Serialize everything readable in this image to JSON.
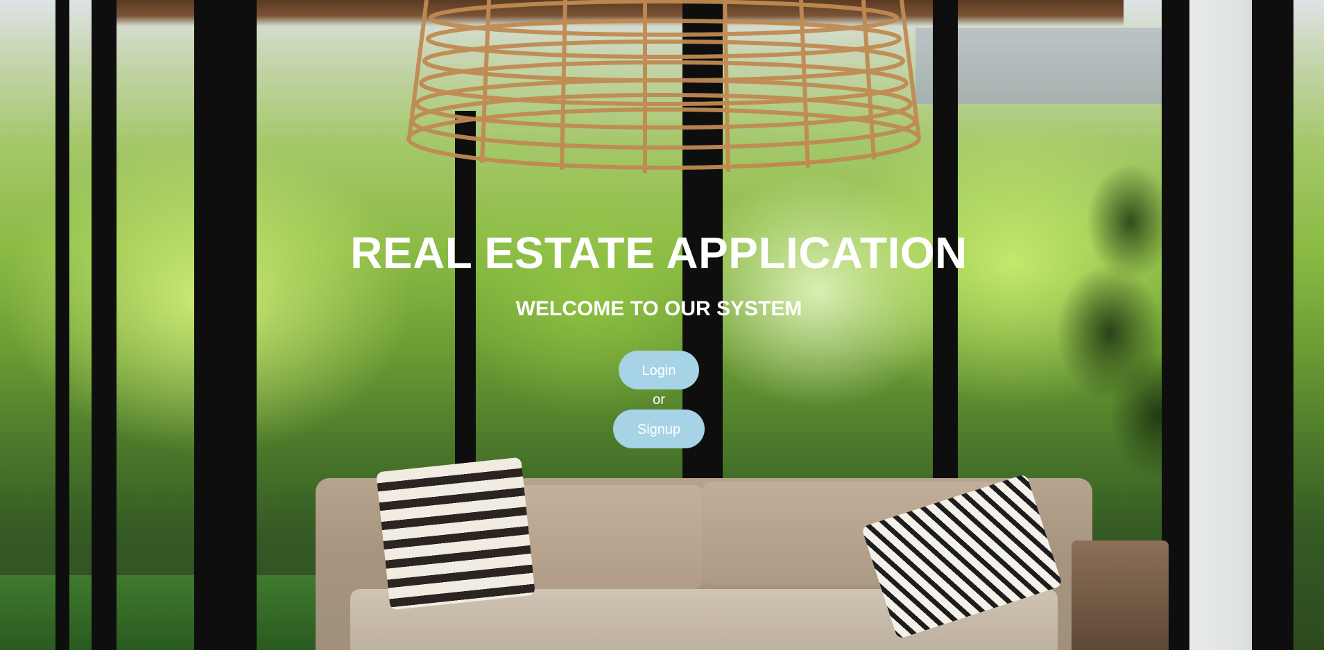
{
  "hero": {
    "title": "REAL ESTATE APPLICATION",
    "subtitle": "WELCOME TO OUR SYSTEM",
    "background_description_icon": "patio-photo",
    "login_label": "Login",
    "separator": "or",
    "signup_label": "Signup"
  },
  "colors": {
    "button_bg": "#a6d3e6",
    "text": "#ffffff"
  }
}
